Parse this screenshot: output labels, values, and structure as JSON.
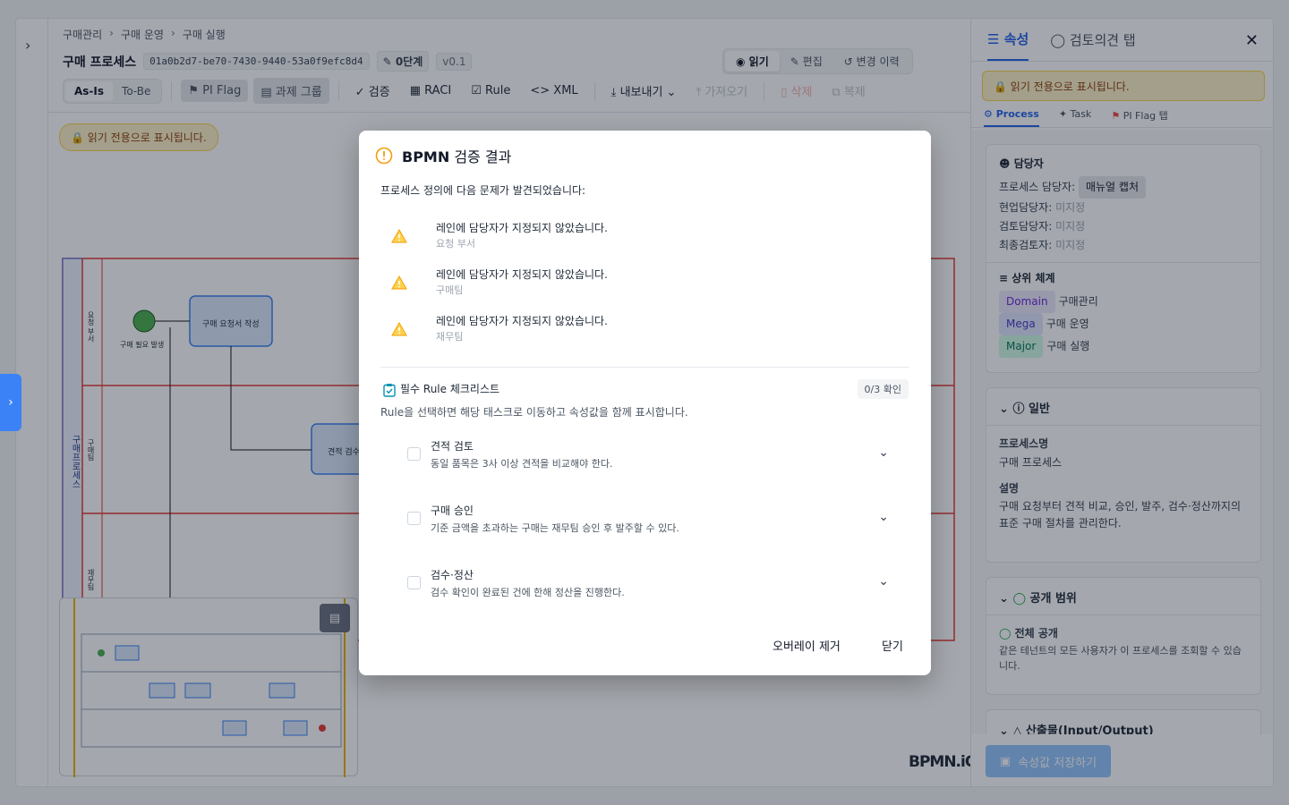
{
  "breadcrumb": [
    "구매관리",
    "구매 운영",
    "구매 실행"
  ],
  "header": {
    "title": "구매 프로세스",
    "process_id": "01a0b2d7-be70-7430-9440-53a0f9efc8d4",
    "stage": "0단계",
    "version": "v0.1"
  },
  "modes": {
    "read": "읽기",
    "edit": "편집",
    "history": "변경 이력"
  },
  "toolbar": {
    "as_is": "As-Is",
    "to_be": "To-Be",
    "pi_flag": "PI Flag",
    "task_group": "과제 그룹",
    "validate": "검증",
    "raci": "RACI",
    "rule": "Rule",
    "xml": "XML",
    "export": "내보내기",
    "import": "가져오기",
    "delete": "삭제",
    "copy": "복제"
  },
  "canvas": {
    "read_only": "읽기 전용으로 표시됩니다.",
    "pool_label": "구매프로세스",
    "lanes": [
      "요청 부서",
      "구매팀",
      "재무팀"
    ],
    "start_event": "구매 필요 발생",
    "task1": "구매 요청서 작성",
    "task2": "견적 검수",
    "watermark": "BPMN.iO"
  },
  "sidebar": {
    "tab_props": "속성",
    "tab_review": "검토의견 탭",
    "read_only": "읽기 전용으로 표시됩니다.",
    "sub_process": "Process",
    "sub_task": "Task",
    "sub_pi": "PI Flag 탭",
    "owner": {
      "title": "담당자",
      "owner_label": "프로세스 담당자:",
      "owner_value": "매뉴얼 캡처",
      "collab_label": "현업담당자:",
      "review_label": "검토담당자:",
      "final_label": "최종검토자:",
      "unassigned": "미지정"
    },
    "hier": {
      "title": "상위 체계",
      "domain_tag": "Domain",
      "domain": "구매관리",
      "mega_tag": "Mega",
      "mega": "구매 운영",
      "major_tag": "Major",
      "major": "구매 실행"
    },
    "general": {
      "title": "일반",
      "name_label": "프로세스명",
      "name": "구매 프로세스",
      "desc_label": "설명",
      "desc": "구매 요청부터 견적 비교, 승인, 발주, 검수·정산까지의 표준 구매 절차를 관리한다."
    },
    "scope": {
      "title": "공개 범위",
      "value": "전체 공개",
      "desc": "같은 테넌트의 모든 사용자가 이 프로세스를 조회할 수 있습니다."
    },
    "io": {
      "title": "산출물(Input/Output)"
    },
    "save": "속성값 저장하기"
  },
  "modal": {
    "title_bold": "BPMN",
    "title_rest": "검증 결과",
    "intro": "프로세스 정의에 다음 문제가 발견되었습니다:",
    "issues": [
      {
        "text": "레인에 담당자가 지정되지 않았습니다.",
        "lane": "요청 부서"
      },
      {
        "text": "레인에 담당자가 지정되지 않았습니다.",
        "lane": "구매팀"
      },
      {
        "text": "레인에 담당자가 지정되지 않았습니다.",
        "lane": "재무팀"
      }
    ],
    "checklist_title": "필수 Rule 체크리스트",
    "checklist_count": "0/3 확인",
    "checklist_desc": "Rule을 선택하면 해당 태스크로 이동하고 속성값을 함께 표시합니다.",
    "rules": [
      {
        "title": "견적 검토",
        "desc": "동일 품목은 3사 이상 견적을 비교해야 한다."
      },
      {
        "title": "구매 승인",
        "desc": "기준 금액을 초과하는 구매는 재무팀 승인 후 발주할 수 있다."
      },
      {
        "title": "검수·정산",
        "desc": "검수 확인이 완료된 건에 한해 정산을 진행한다."
      }
    ],
    "remove_overlay": "오버레이 제거",
    "close": "닫기"
  },
  "colors": {
    "accent": "#2563eb",
    "warning": "#f59e0b",
    "lane_border": "#e53935",
    "task_fill": "#dbeafe"
  }
}
